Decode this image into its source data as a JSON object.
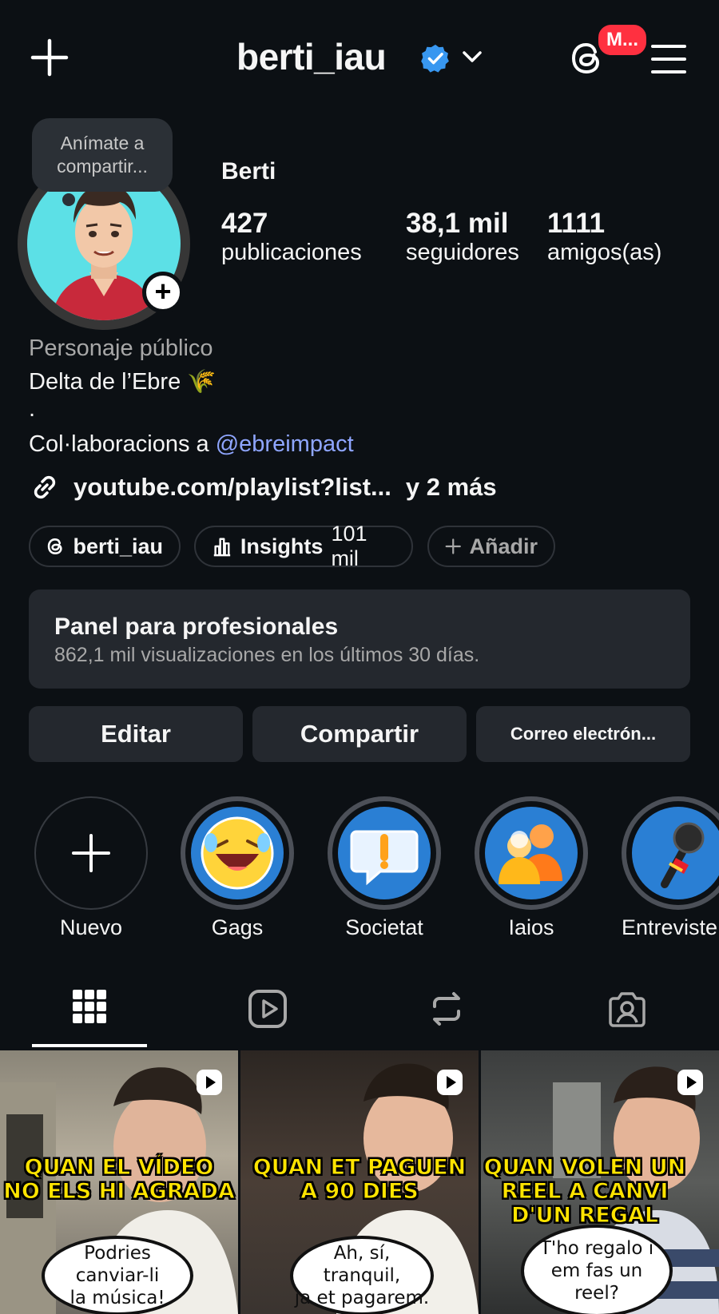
{
  "header": {
    "username": "berti_iau",
    "notification_badge": "M...",
    "icons": [
      "plus-icon",
      "verified-badge-icon",
      "chevron-down-icon",
      "threads-icon",
      "menu-icon"
    ]
  },
  "profile": {
    "bubble_text_1": "Anímate a",
    "bubble_text_2": "compartir...",
    "display_name": "Berti",
    "stats": [
      {
        "value": "427",
        "label": "publicaciones"
      },
      {
        "value": "38,1 mil",
        "label": "seguidores"
      },
      {
        "value": "1111",
        "label": "amigos(as)"
      }
    ]
  },
  "bio": {
    "category": "Personaje público",
    "line1": "Delta de l’Ebre 🌾",
    "line2": ".",
    "line3_prefix": "Col·laboracions a ",
    "line3_mention": "@ebreimpact",
    "link": "youtube.com/playlist?list...",
    "link_more": "y 2 más"
  },
  "chips": {
    "threads": "berti_iau",
    "insights_label": "Insights",
    "insights_value": "101 mil",
    "add": "Añadir"
  },
  "panel": {
    "title": "Panel para profesionales",
    "subtitle": "862,1 mil visualizaciones en los últimos 30 días."
  },
  "buttons": {
    "edit": "Editar",
    "share": "Compartir",
    "email": "Correo electrón..."
  },
  "highlights": [
    {
      "label": "Nuevo"
    },
    {
      "label": "Gags"
    },
    {
      "label": "Societat"
    },
    {
      "label": "Iaios"
    },
    {
      "label": "Entreviste"
    }
  ],
  "tabs": [
    "grid-icon",
    "reels-icon",
    "reposts-icon",
    "tagged-icon"
  ],
  "posts": [
    {
      "cap1": "QUAN EL VÍDEO",
      "cap2": "NO ELS HI AGRADA",
      "speech1": "Podries canviar-li",
      "speech2": "la música!"
    },
    {
      "cap1": "QUAN ET PAGUEN",
      "cap2": "A 90 DIES",
      "speech1": "Ah, sí, tranquil,",
      "speech2": "ja et pagarem."
    },
    {
      "cap1": "QUAN VOLEN UN",
      "cap2": "REEL A CANVI",
      "cap3": "D'UN REGAL",
      "speech1": "T'ho regalo i",
      "speech2": "em fas un",
      "speech3": "reel?"
    }
  ],
  "colors": {
    "background": "#0c1014",
    "surface": "#24282e",
    "mention": "#8fa6ff",
    "verified": "#3897f0",
    "notification": "#ff3040",
    "caption_yellow": "#ffe400",
    "caption_red": "#e8202a",
    "caption_magenta": "#ff3ca0",
    "caption_cyan": "#2ee6f0"
  }
}
